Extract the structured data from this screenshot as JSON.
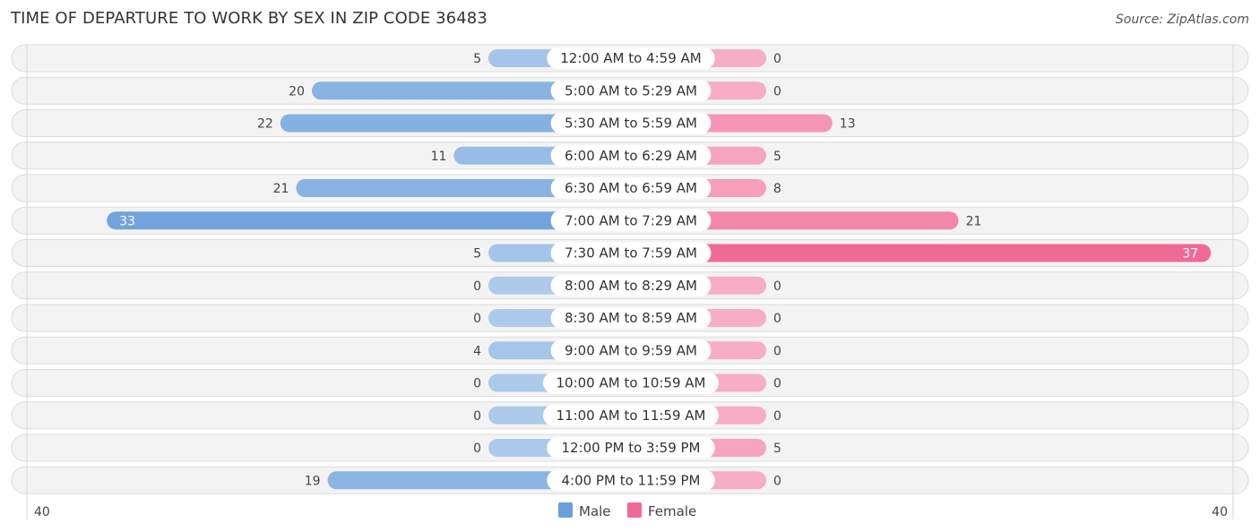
{
  "chart_data": {
    "type": "bar",
    "orientation": "horizontal-diverging",
    "title": "TIME OF DEPARTURE TO WORK BY SEX IN ZIP CODE 36483",
    "source": "Source: ZipAtlas.com",
    "categories": [
      "12:00 AM to 4:59 AM",
      "5:00 AM to 5:29 AM",
      "5:30 AM to 5:59 AM",
      "6:00 AM to 6:29 AM",
      "6:30 AM to 6:59 AM",
      "7:00 AM to 7:29 AM",
      "7:30 AM to 7:59 AM",
      "8:00 AM to 8:29 AM",
      "8:30 AM to 8:59 AM",
      "9:00 AM to 9:59 AM",
      "10:00 AM to 10:59 AM",
      "11:00 AM to 11:59 AM",
      "12:00 PM to 3:59 PM",
      "4:00 PM to 11:59 PM"
    ],
    "series": [
      {
        "name": "Male",
        "side": "left",
        "color": "#6a9fdb",
        "values": [
          5,
          20,
          22,
          11,
          21,
          33,
          5,
          0,
          0,
          4,
          0,
          0,
          0,
          19
        ]
      },
      {
        "name": "Female",
        "side": "right",
        "color": "#f06a96",
        "values": [
          0,
          0,
          13,
          5,
          8,
          21,
          37,
          0,
          0,
          0,
          0,
          0,
          5,
          0
        ]
      }
    ],
    "xlim": [
      40,
      40
    ],
    "axis_labels": {
      "left": "40",
      "right": "40"
    },
    "legend": {
      "position": "bottom-center",
      "items": [
        "Male",
        "Female"
      ]
    },
    "grid": false
  }
}
